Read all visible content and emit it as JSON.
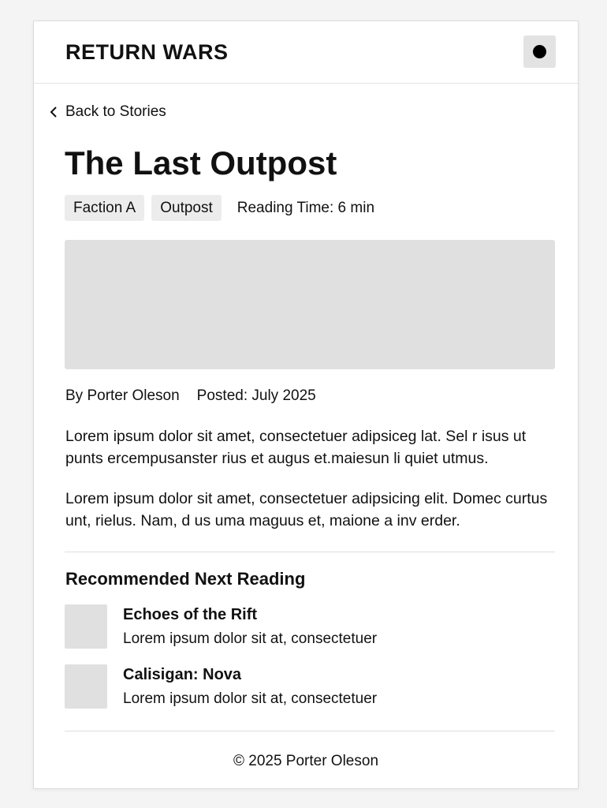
{
  "header": {
    "brand": "RETURN WARS",
    "menu_icon": "circle-dot-icon"
  },
  "nav": {
    "back_label": "Back to Stories",
    "back_icon": "chevron-left-icon"
  },
  "article": {
    "title": "The Last Outpost",
    "tags": [
      "Faction A",
      "Outpost"
    ],
    "reading_time": "Reading Time: 6 min",
    "author": "By Porter Oleson",
    "posted": "Posted: July 2025",
    "paragraphs": [
      "Lorem ipsum dolor sit amet, consectetuer adipsiceg lat. Sel r isus ut punts ercempusanster rius et augus et.maiesun li quiet utmus.",
      "Lorem ipsum dolor sit amet, consectetuer adipsicing elit. Domec curtus unt, rielus. Nam, d us uma maguus et, maione a inv erder."
    ]
  },
  "recommended": {
    "heading": "Recommended Next Reading",
    "items": [
      {
        "title": "Echoes of the Rift",
        "desc": "Lorem ipsum dolor sit at, consectetuer"
      },
      {
        "title": "Calisigan: Nova",
        "desc": "Lorem ipsum dolor sit at, consectetuer"
      }
    ]
  },
  "footer": {
    "copyright": "© 2025 Porter Oleson"
  },
  "colors": {
    "background": "#f4f4f4",
    "card": "#ffffff",
    "placeholder": "#e0e0e0",
    "tag": "#ececec",
    "text": "#111111"
  }
}
